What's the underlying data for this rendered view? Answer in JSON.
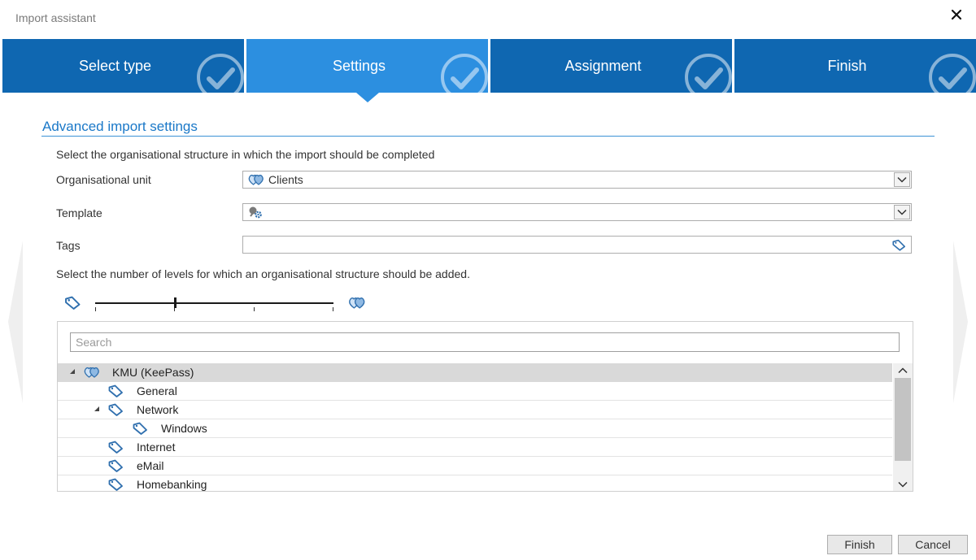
{
  "window": {
    "title": "Import assistant"
  },
  "steps": [
    {
      "label": "Select type"
    },
    {
      "label": "Settings"
    },
    {
      "label": "Assignment"
    },
    {
      "label": "Finish"
    }
  ],
  "section": {
    "title": "Advanced import settings",
    "structure_prompt": "Select the organisational structure in which the import should be completed"
  },
  "form": {
    "org_unit_label": "Organisational unit",
    "org_unit_value": "Clients",
    "template_label": "Template",
    "template_value": "",
    "tags_label": "Tags",
    "tags_value": ""
  },
  "levels": {
    "prompt": "Select the number of levels for which an organisational structure should be added."
  },
  "tree": {
    "search_placeholder": "Search",
    "items": [
      {
        "label": "KMU (KeePass)"
      },
      {
        "label": "General"
      },
      {
        "label": "Network"
      },
      {
        "label": "Windows"
      },
      {
        "label": "Internet"
      },
      {
        "label": "eMail"
      },
      {
        "label": "Homebanking"
      }
    ]
  },
  "buttons": {
    "finish": "Finish",
    "cancel": "Cancel"
  },
  "colors": {
    "step_inactive": "#0f67b1",
    "step_active": "#2c8fe0",
    "accent": "#1a78c8",
    "icon_blue": "#2f6fae",
    "row_selected": "#d9d9d9"
  },
  "icons": {
    "close": "close-icon",
    "step_check": "checkmark-circle-icon",
    "org_unit": "hearts-icon",
    "template": "template-gear-icon",
    "tag": "tag-icon",
    "dropdown": "chevron-down-icon",
    "expander": "triangle-expand-icon"
  }
}
